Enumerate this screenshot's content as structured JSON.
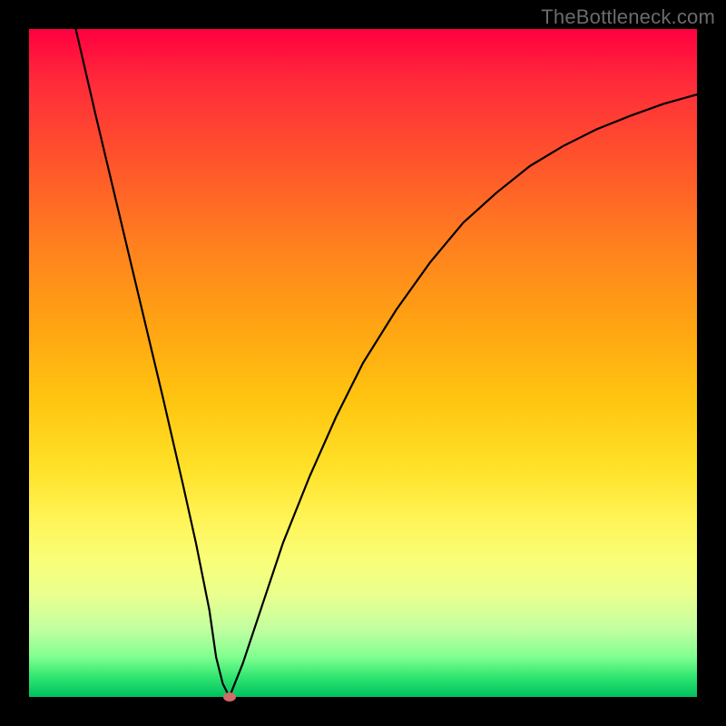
{
  "watermark": "TheBottleneck.com",
  "chart_data": {
    "type": "line",
    "title": "",
    "xlabel": "",
    "ylabel": "",
    "xlim": [
      0,
      100
    ],
    "ylim": [
      0,
      100
    ],
    "background": "rainbow-gradient (red top → green bottom)",
    "series": [
      {
        "name": "curve",
        "x": [
          7,
          10,
          15,
          20,
          23,
          25,
          27,
          28,
          29,
          30,
          32,
          35,
          38,
          42,
          46,
          50,
          55,
          60,
          65,
          70,
          75,
          80,
          85,
          90,
          95,
          100
        ],
        "y": [
          100,
          87,
          66,
          45,
          32,
          23,
          13,
          6,
          2,
          0,
          5,
          14,
          23,
          33,
          42,
          50,
          58,
          65,
          71,
          75.5,
          79.5,
          82.5,
          85,
          87,
          88.8,
          90.2
        ]
      }
    ],
    "marker": {
      "x": 30,
      "y": 0,
      "color": "#d46a6a"
    }
  },
  "colors": {
    "curve": "#000000",
    "frame": "#000000"
  }
}
